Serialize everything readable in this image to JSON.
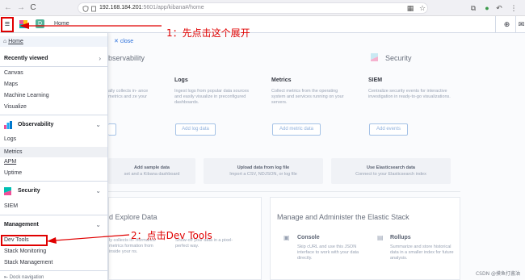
{
  "browser": {
    "url_host": "192.168.184.201",
    "url_rest": ":5601/app/kibana#/home",
    "nav_back": "←",
    "nav_forward": "→",
    "nav_reload": "C"
  },
  "header": {
    "menu_icon": "≡",
    "space_letter": "D",
    "breadcrumb": "Home"
  },
  "drawer": {
    "home": "Home",
    "recently_viewed": {
      "title": "Recently viewed",
      "items": [
        "Canvas",
        "Maps",
        "Machine Learning",
        "Visualize"
      ]
    },
    "observability": {
      "title": "Observability",
      "items": [
        "Logs",
        "Metrics",
        "APM",
        "Uptime"
      ]
    },
    "security": {
      "title": "Security",
      "items": [
        "SIEM"
      ]
    },
    "management": {
      "title": "Management",
      "items": [
        "Dev Tools",
        "Stack Monitoring",
        "Stack Management"
      ]
    },
    "dock": "Dock navigation"
  },
  "main": {
    "close": "close",
    "observability_title": "bservability",
    "observability_desc": "ally collects in- ance metrics and ze your",
    "logs": {
      "title": "Logs",
      "desc": "Ingest logs from popular data sources and easily visualize in preconfigured dashboards.",
      "button": "Add log data"
    },
    "metrics": {
      "title": "Metrics",
      "desc": "Collect metrics from the operating system and services running on your servers.",
      "button": "Add metric data"
    },
    "security_title": "Security",
    "siem": {
      "title": "SIEM",
      "desc": "Centralize security events for interactive investigation in ready-to-go visualizations.",
      "button": "Add events"
    },
    "tiles": [
      {
        "title": "Add sample data",
        "desc": "set and a Kibana dashboard"
      },
      {
        "title": "Upload data from log file",
        "desc": "Import a CSV, NDJSON, or log file"
      },
      {
        "title": "Use Elasticsearch data",
        "desc": "Connect to your Elasticsearch index"
      }
    ],
    "explore_title": "d Explore Data",
    "explore_desc1": "ly collects in- rformance metrics formation from inside your ns.",
    "explore_desc2": "Show-off your data in a pixel-perfect way.",
    "manage_title": "Manage and Administer the Elastic Stack",
    "console": {
      "title": "Console",
      "desc": "Skip cURL and use this JSON interface to work with your data directly."
    },
    "rollups": {
      "title": "Rollups",
      "desc": "Summarize and store historical data in a smaller index for future analysis."
    }
  },
  "annotations": {
    "step1": "1：先点击这个展开",
    "step2": "2：点击Dev Tools"
  },
  "watermark": "CSDN @摸鱼打酱油",
  "colors": {
    "annotation_red": "#e00000",
    "link_blue": "#2a6fdb",
    "space_green": "#54b399"
  }
}
